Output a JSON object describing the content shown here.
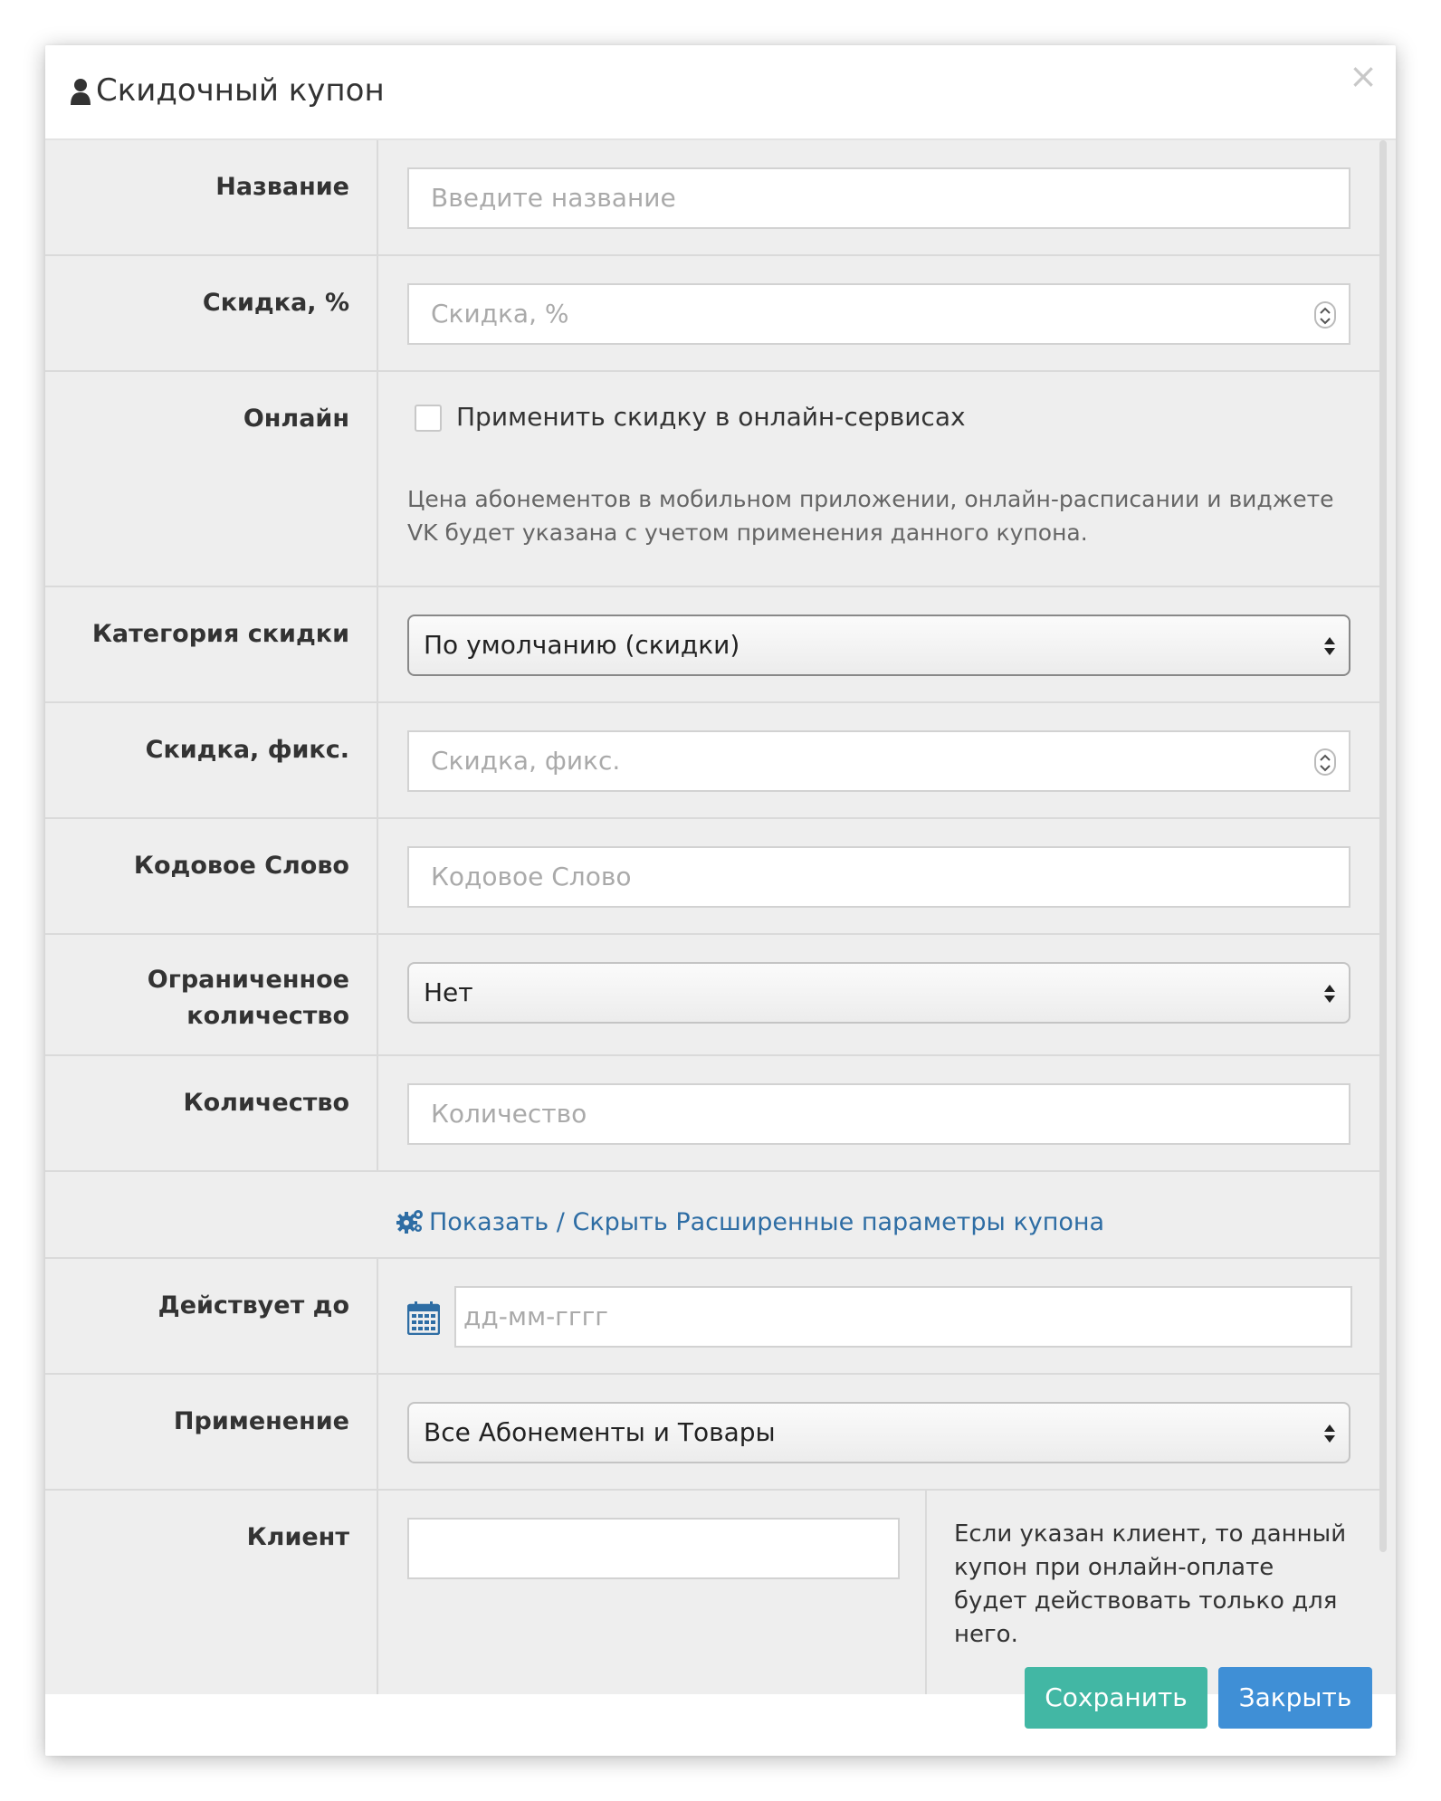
{
  "modal": {
    "title": "Скидочный купон",
    "close_symbol": "×",
    "title_icon": "user-icon"
  },
  "fields": {
    "name": {
      "label": "Название",
      "placeholder": "Введите название"
    },
    "discount_percent": {
      "label": "Скидка, %",
      "placeholder": "Скидка, %"
    },
    "online": {
      "label": "Онлайн",
      "checkbox_label": "Применить скидку в онлайн-сервисах",
      "checked": false,
      "help": "Цена абонементов в мобильном приложении, онлайн-расписании и виджете VK будет указана с учетом применения данного купона."
    },
    "category": {
      "label": "Категория скидки",
      "value": "По умолчанию (скидки)"
    },
    "discount_fixed": {
      "label": "Скидка, фикс.",
      "placeholder": "Скидка, фикс."
    },
    "codeword": {
      "label": "Кодовое Слово",
      "placeholder": "Кодовое Слово"
    },
    "limited": {
      "label_line1": "Ограниченное",
      "label_line2": "количество",
      "value": "Нет"
    },
    "quantity": {
      "label": "Количество",
      "placeholder": "Количество"
    },
    "advanced_link": "Показать / Скрыть Расширенные параметры купона",
    "valid_until": {
      "label": "Действует до",
      "placeholder": "дд-мм-гггг"
    },
    "application": {
      "label": "Применение",
      "value": "Все Абонементы и Товары"
    },
    "client": {
      "label": "Клиент",
      "value": "",
      "help": "Если указан клиент, то данный купон при онлайн-оплате будет действовать только для него."
    }
  },
  "footer": {
    "save_label": "Сохранить",
    "close_label": "Закрыть"
  },
  "colors": {
    "save": "#42b7a4",
    "close": "#3f8fd6",
    "link": "#2e6da4",
    "body_bg": "#eeeeee"
  }
}
